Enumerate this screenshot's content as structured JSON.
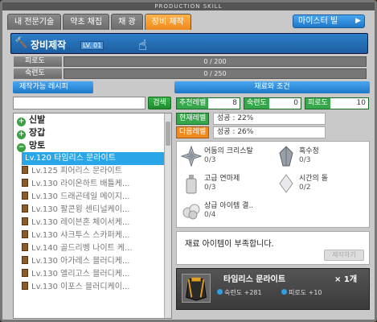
{
  "window": {
    "title": "PRODUCTION SKILL"
  },
  "tabs": [
    {
      "label": "내 전문기술",
      "active": false
    },
    {
      "label": "약초 채집",
      "active": false
    },
    {
      "label": "채 광",
      "active": false
    },
    {
      "label": "장비 제작",
      "active": true
    }
  ],
  "master_button": {
    "label": "마이스터 빌",
    "arrow": "▶"
  },
  "header": {
    "title": "장비제작",
    "level": "LV. 01",
    "icon": "hammer-icon",
    "cursor": "hand-cursor-icon"
  },
  "bars": [
    {
      "label": "피로도",
      "text": "0 / 200",
      "value": 0
    },
    {
      "label": "숙련도",
      "text": "0 / 250",
      "value": 0
    }
  ],
  "left": {
    "title": "제작가능 레시피",
    "search_button": "검색",
    "search_value": "",
    "categories": [
      {
        "label": "신발",
        "mark": "+"
      },
      {
        "label": "장갑",
        "mark": "+"
      },
      {
        "label": "망토",
        "mark": "−"
      }
    ],
    "items": [
      {
        "label": "Lv.120 타임리스 문라이트",
        "selected": true
      },
      {
        "label": "Lv.125 피어리스 문라이트",
        "selected": false
      },
      {
        "label": "Lv.130 라이온하트 배틀케...",
        "selected": false
      },
      {
        "label": "Lv.130 드래곤테일 메이지...",
        "selected": false
      },
      {
        "label": "Lv.130 팔콘윙 센티널케이...",
        "selected": false
      },
      {
        "label": "Lv.130 레이븐혼 체이서케...",
        "selected": false
      },
      {
        "label": "Lv.130 샤크투스 스카퍼케...",
        "selected": false
      },
      {
        "label": "Lv.140 골드리벵 나이트 케...",
        "selected": false
      },
      {
        "label": "Lv.130 아가레스 블러디케...",
        "selected": false
      },
      {
        "label": "Lv.130 엘리고스 블러디케...",
        "selected": false
      },
      {
        "label": "Lv.130 이포스 블러디케이...",
        "selected": false
      }
    ]
  },
  "right": {
    "title": "재료와 조건",
    "requirements": [
      {
        "label": "추천레벨",
        "value": "8"
      },
      {
        "label": "숙련도",
        "value": "0"
      },
      {
        "label": "피로도",
        "value": "10"
      }
    ],
    "current_level": {
      "label": "현재레벨",
      "value": "성공 : 22%"
    },
    "next_level": {
      "label": "다음레벨",
      "value": "성공 : 26%"
    },
    "materials": [
      {
        "name": "어둠의 크리스탈",
        "count": "0/3",
        "icon": "dark-crystal-icon"
      },
      {
        "name": "흑수정",
        "count": "0/3",
        "icon": "black-crystal-icon"
      },
      {
        "name": "고급 연마제",
        "count": "0/3",
        "icon": "polish-bottle-icon"
      },
      {
        "name": "시간의 돌",
        "count": "0/2",
        "icon": "time-stone-icon"
      },
      {
        "name": "상급 아이템 결..",
        "count": "0/4",
        "icon": "item-crystal-icon"
      }
    ],
    "message": "재료 아이템이 부족합니다.",
    "craft_button": "제작하기",
    "result": {
      "name": "타임리스 문라이트",
      "count": "× 1개",
      "stat1": "숙련도 +281",
      "stat2": "피로도 +10",
      "icon": "cape-icon"
    }
  }
}
